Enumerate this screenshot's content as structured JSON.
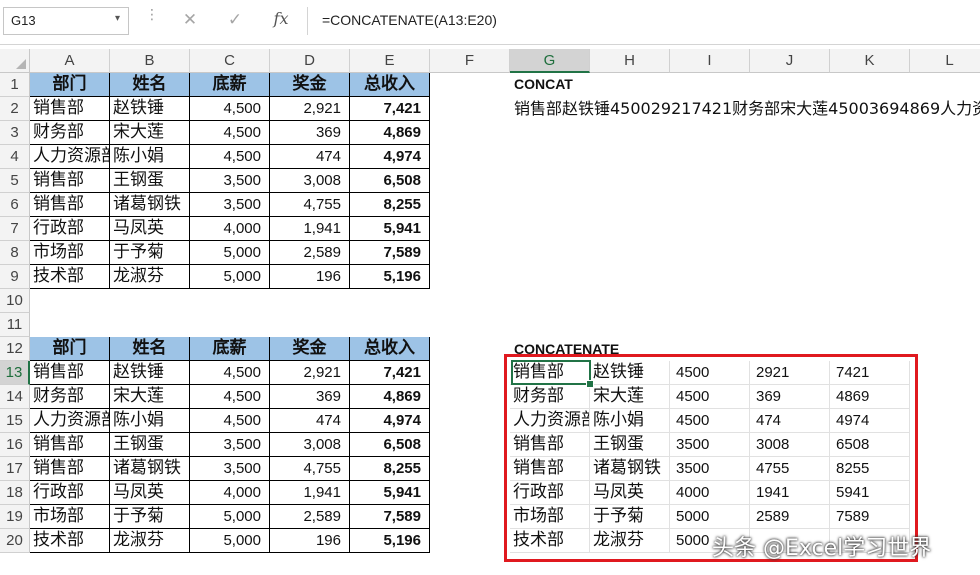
{
  "name_box": "G13",
  "formula": "=CONCATENATE(A13:E20)",
  "icons": {
    "cancel": "✕",
    "enter": "✓",
    "fx": "fx",
    "dropdown": "▾"
  },
  "columns": [
    "A",
    "B",
    "C",
    "D",
    "E",
    "F",
    "G",
    "H",
    "I",
    "J",
    "K",
    "L"
  ],
  "rows": [
    "1",
    "2",
    "3",
    "4",
    "5",
    "6",
    "7",
    "8",
    "9",
    "10",
    "11",
    "12",
    "13",
    "14",
    "15",
    "16",
    "17",
    "18",
    "19",
    "20"
  ],
  "table1": {
    "headers": [
      "部门",
      "姓名",
      "底薪",
      "奖金",
      "总收入"
    ],
    "rows": [
      [
        "销售部",
        "赵铁锤",
        "4,500",
        "2,921",
        "7,421"
      ],
      [
        "财务部",
        "宋大莲",
        "4,500",
        "369",
        "4,869"
      ],
      [
        "人力资源部",
        "陈小娟",
        "4,500",
        "474",
        "4,974"
      ],
      [
        "销售部",
        "王钢蛋",
        "3,500",
        "3,008",
        "6,508"
      ],
      [
        "销售部",
        "诸葛钢铁",
        "3,500",
        "4,755",
        "8,255"
      ],
      [
        "行政部",
        "马凤英",
        "4,000",
        "1,941",
        "5,941"
      ],
      [
        "市场部",
        "于予菊",
        "5,000",
        "2,589",
        "7,589"
      ],
      [
        "技术部",
        "龙淑芬",
        "5,000",
        "196",
        "5,196"
      ]
    ]
  },
  "table2": {
    "headers": [
      "部门",
      "姓名",
      "底薪",
      "奖金",
      "总收入"
    ],
    "rows": [
      [
        "销售部",
        "赵铁锤",
        "4,500",
        "2,921",
        "7,421"
      ],
      [
        "财务部",
        "宋大莲",
        "4,500",
        "369",
        "4,869"
      ],
      [
        "人力资源部",
        "陈小娟",
        "4,500",
        "474",
        "4,974"
      ],
      [
        "销售部",
        "王钢蛋",
        "3,500",
        "3,008",
        "6,508"
      ],
      [
        "销售部",
        "诸葛钢铁",
        "3,500",
        "4,755",
        "8,255"
      ],
      [
        "行政部",
        "马凤英",
        "4,000",
        "1,941",
        "5,941"
      ],
      [
        "市场部",
        "于予菊",
        "5,000",
        "2,589",
        "7,589"
      ],
      [
        "技术部",
        "龙淑芬",
        "5,000",
        "196",
        "5,196"
      ]
    ]
  },
  "concat": {
    "label": "CONCAT",
    "result": "销售部赵铁锤450029217421财务部宋大莲45003694869人力资"
  },
  "concatenate": {
    "label": "CONCATENATE",
    "rows": [
      [
        "销售部",
        "赵铁锤",
        "4500",
        "2921",
        "7421"
      ],
      [
        "财务部",
        "宋大莲",
        "4500",
        "369",
        "4869"
      ],
      [
        "人力资源部",
        "陈小娟",
        "4500",
        "474",
        "4974"
      ],
      [
        "销售部",
        "王钢蛋",
        "3500",
        "3008",
        "6508"
      ],
      [
        "销售部",
        "诸葛钢铁",
        "3500",
        "4755",
        "8255"
      ],
      [
        "行政部",
        "马凤英",
        "4000",
        "1941",
        "5941"
      ],
      [
        "市场部",
        "于予菊",
        "5000",
        "2589",
        "7589"
      ],
      [
        "技术部",
        "龙淑芬",
        "5000",
        "",
        ""
      ]
    ]
  },
  "watermark": "头条 @Excel学习世界",
  "colors": {
    "header_fill": "#9dc3e6",
    "selection": "#217346",
    "highlight_box": "#e0191f"
  }
}
